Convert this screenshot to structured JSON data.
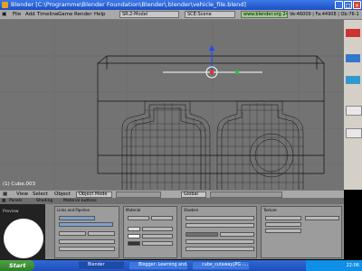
{
  "window": {
    "title": "Blender [C:\\Programme\\Blender Foundation\\Blender\\.blender\\vehicle_file.blend]"
  },
  "menubar": {
    "items": [
      "File",
      "Add",
      "Timeline",
      "Game",
      "Render",
      "Help"
    ],
    "screen": "SR:2-Model",
    "scene": "SCE:Scene",
    "url": "www.blender.org 244",
    "stats": "Ve:46009 | Fa:44908 | Ob:76-1"
  },
  "viewport": {
    "label": "(1) Cube.003"
  },
  "header3d": {
    "items": [
      "View",
      "Select",
      "Object"
    ],
    "mode": "Object Mode",
    "pivot": "Global"
  },
  "panels": {
    "header_items": [
      "Panels",
      "Shading",
      "Material buttons"
    ],
    "preview": "Preview",
    "links": "Links and Pipeline",
    "material": "Material",
    "shaders": "Shaders",
    "texture": "Texture"
  },
  "taskbar": {
    "start": "Start",
    "items": [
      "Blender",
      "Blogger: Learning and...",
      "cube_cutaway.JPG -..."
    ],
    "clock": "22:06"
  }
}
